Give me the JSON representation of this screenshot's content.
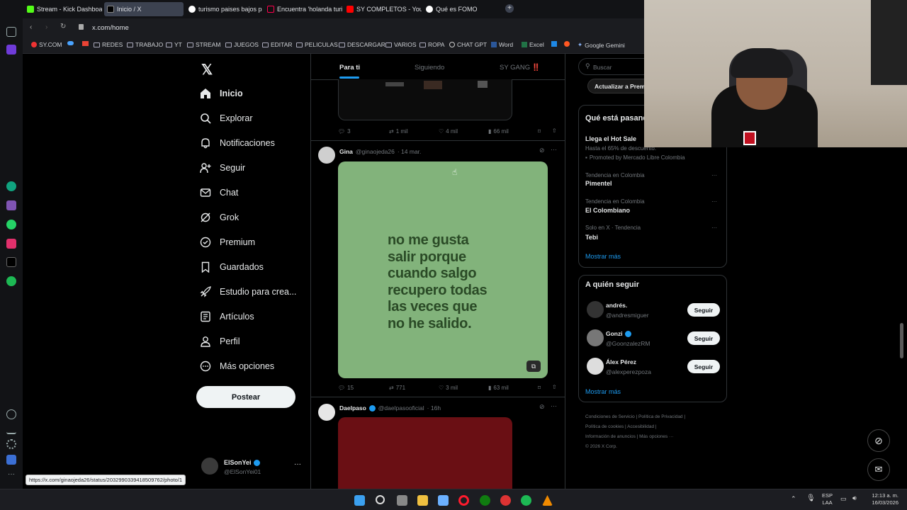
{
  "browser": {
    "tabs": [
      {
        "label": "Stream - Kick Dashboard",
        "color": "#53fc18"
      },
      {
        "label": "Inicio / X",
        "color": "#000000"
      },
      {
        "label": "turismo paises bajos paise",
        "color": "#ffffff"
      },
      {
        "label": "Encuentra 'holanda turism",
        "color": "#ff0050"
      },
      {
        "label": "SY COMPLETOS - YouTube",
        "color": "#ff0000"
      },
      {
        "label": "Qué es FOMO",
        "color": "#ffffff"
      }
    ],
    "url": "x.com/home",
    "bookmarks": [
      "SY.COM",
      "REDES",
      "TRABAJO",
      "YT",
      "STREAM",
      "JUEGOS",
      "EDITAR",
      "PELICULAS",
      "DESCARGAR",
      "VARIOS",
      "ROPA",
      "CHAT GPT",
      "Word",
      "Excel",
      "Google Gemini"
    ],
    "status_url": "https://x.com/ginaojeda26/status/2032990339418509762/photo/1"
  },
  "nav": {
    "items": [
      {
        "label": "Inicio",
        "icon": "home-icon"
      },
      {
        "label": "Explorar",
        "icon": "search-icon"
      },
      {
        "label": "Notificaciones",
        "icon": "bell-icon"
      },
      {
        "label": "Seguir",
        "icon": "add-person-icon"
      },
      {
        "label": "Chat",
        "icon": "mail-icon"
      },
      {
        "label": "Grok",
        "icon": "grok-icon"
      },
      {
        "label": "Premium",
        "icon": "verified-icon"
      },
      {
        "label": "Guardados",
        "icon": "bookmark-icon"
      },
      {
        "label": "Estudio para crea...",
        "icon": "rocket-icon"
      },
      {
        "label": "Artículos",
        "icon": "article-icon"
      },
      {
        "label": "Perfil",
        "icon": "person-icon"
      },
      {
        "label": "Más opciones",
        "icon": "more-circle-icon"
      }
    ],
    "post_label": "Postear",
    "account": {
      "name": "ElSonYei",
      "handle": "@ElSonYei01"
    }
  },
  "timeline": {
    "tabs": [
      "Para ti",
      "Siguiendo",
      "SY GANG ‼️"
    ],
    "post0_metrics": {
      "replies": "3",
      "reposts": "1 mil",
      "likes": "4 mil",
      "views": "66 mil"
    },
    "post1": {
      "name": "Gina",
      "handle": "@ginaojeda26",
      "date": "· 14 mar.",
      "image_text": [
        "no me gusta",
        "salir porque",
        "cuando salgo",
        "recupero todas",
        "las veces que",
        "no he salido."
      ],
      "image_bg": "#82b37b",
      "image_text_color": "#2a4a26",
      "metrics": {
        "replies": "15",
        "reposts": "771",
        "likes": "3 mil",
        "views": "63 mil"
      }
    },
    "post2": {
      "name": "Daelpaso",
      "handle": "@daelpasooficial",
      "date": "· 16h",
      "image_bg": "#6a0f14"
    }
  },
  "right": {
    "search_placeholder": "Buscar",
    "premium_btn": "Actualizar a Premium",
    "trends_title": "Qué está pasando",
    "promo": {
      "title": "Llega el Hot Sale",
      "desc": "Hasta el 65% de descuento.",
      "promoted": "Promoted by Mercado Libre Colombia"
    },
    "trends": [
      {
        "context": "Tendencia en Colombia",
        "name": "Pimentel"
      },
      {
        "context": "Tendencia en Colombia",
        "name": "El Colombiano"
      },
      {
        "context": "Solo en X · Tendencia",
        "name": "Tebi"
      }
    ],
    "show_more": "Mostrar más",
    "who_title": "A quién seguir",
    "who": [
      {
        "name": "andrés.",
        "handle": "@andresmiguer",
        "btn": "Seguir"
      },
      {
        "name": "Gonzi",
        "handle": "@GoonzalezRM",
        "btn": "Seguir"
      },
      {
        "name": "Álex Pérez",
        "handle": "@alexperezpoza",
        "btn": "Seguir"
      }
    ],
    "who_more": "Mostrar más",
    "footer": [
      "Condiciones de Servicio",
      "Política de Privacidad",
      "Política de cookies",
      "Accesibilidad",
      "Información de anuncios",
      "Más opciones ···",
      "© 2026 X Corp."
    ]
  },
  "taskbar": {
    "lang": "ESP",
    "lang2": "LAA",
    "time": "12:13 a. m.",
    "date": "16/03/2026"
  }
}
